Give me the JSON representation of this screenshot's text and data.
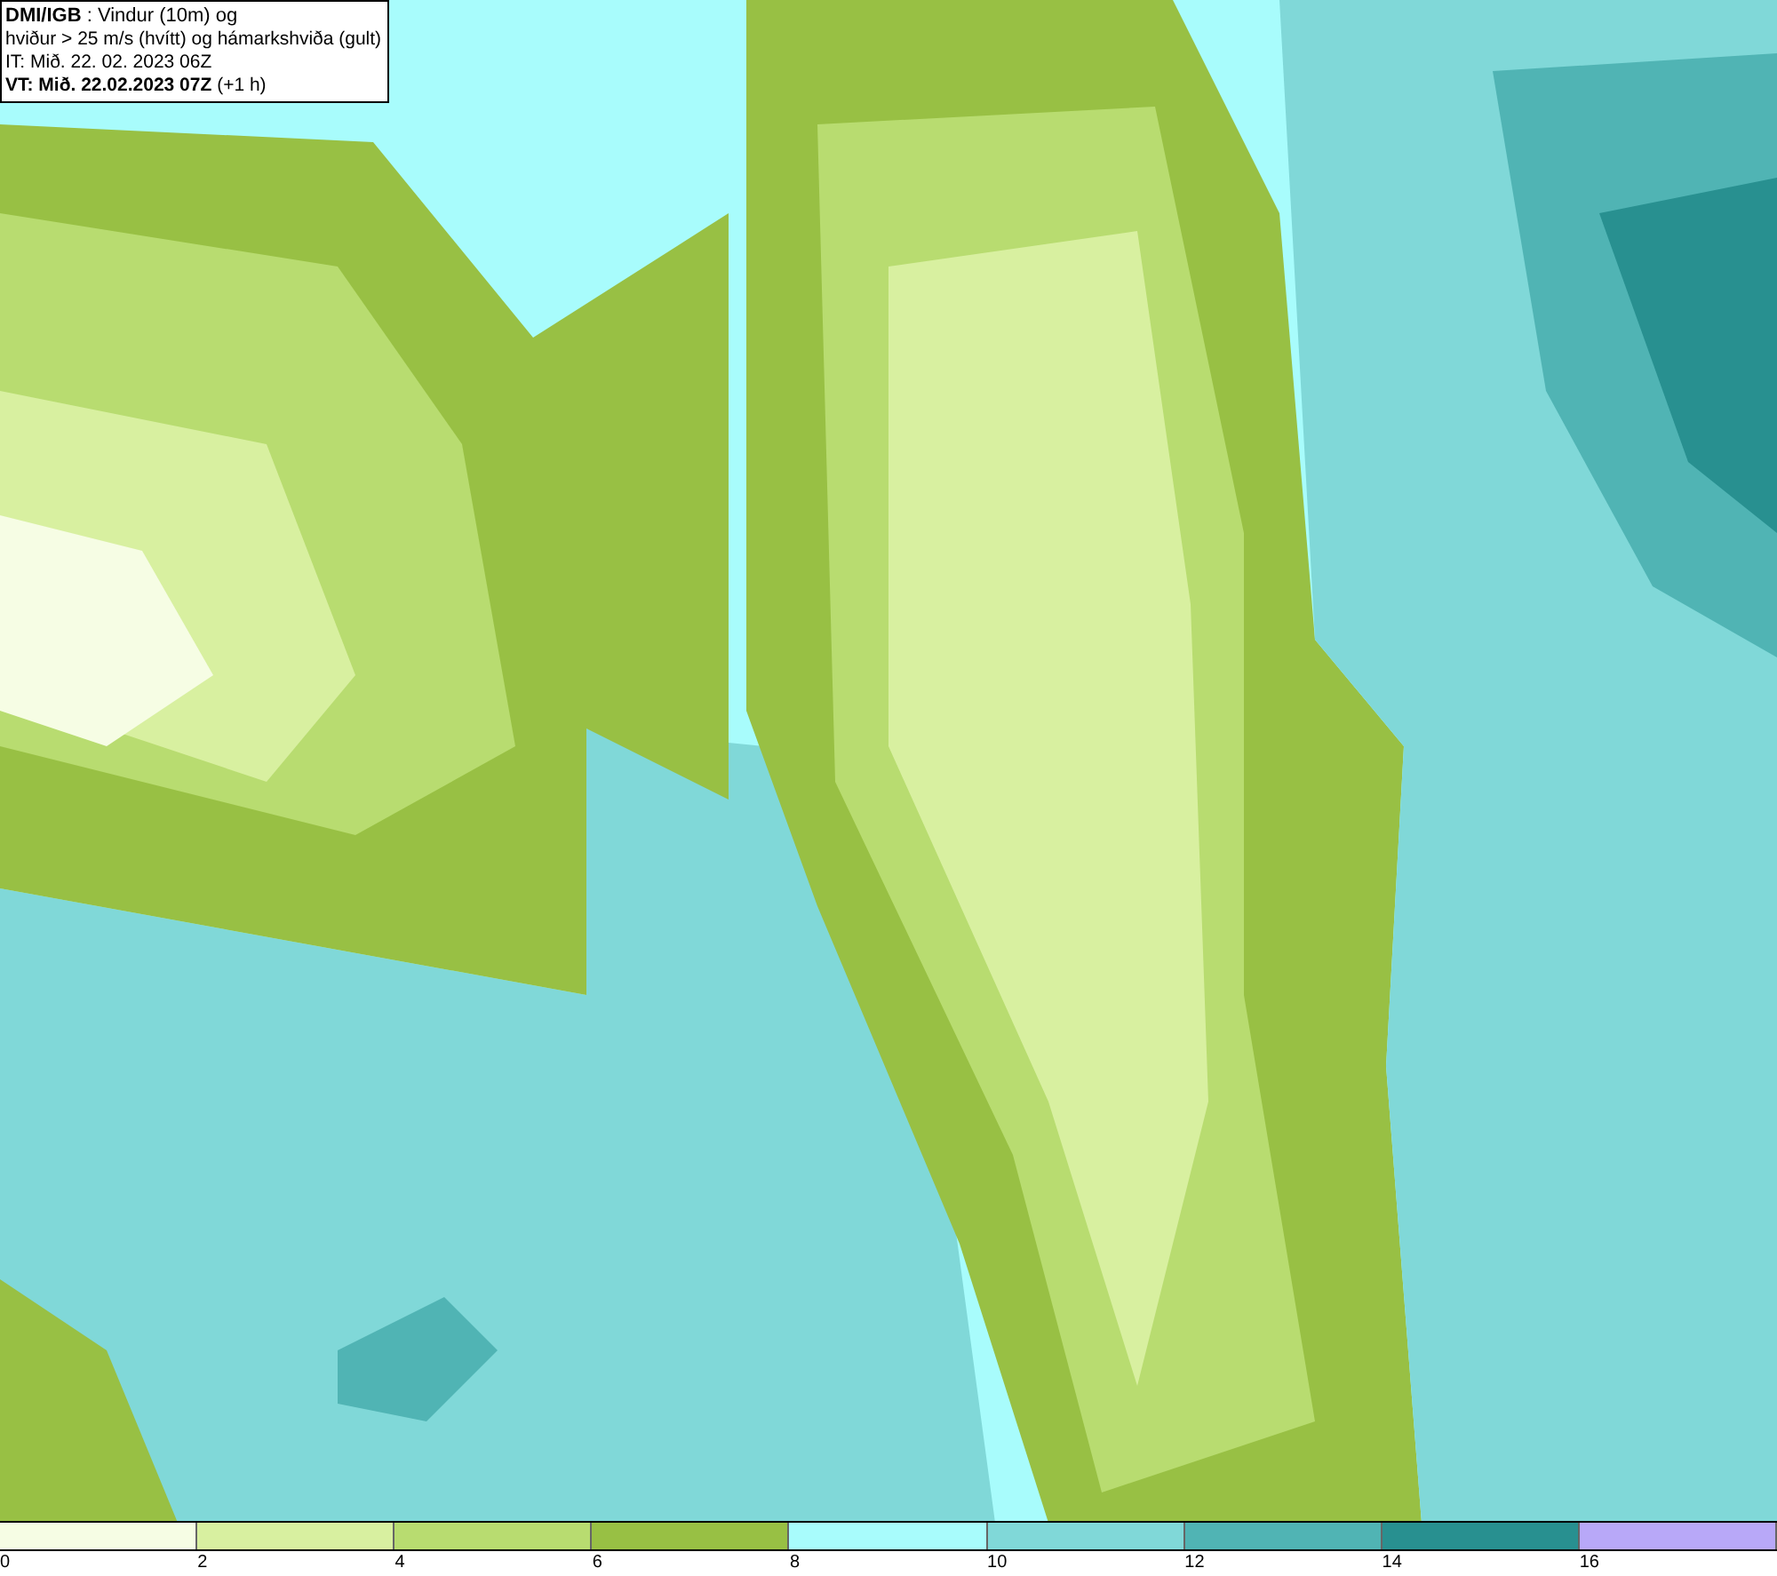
{
  "info_box": {
    "lines": [
      "**DMI/IGB** : Vindur (10m) og",
      "hviður > 25 m/s (hvítt) og hámarkshviða (gult)",
      "IT: Mið. 22. 02. 2023 06Z",
      "**VT: Mið. 22.02.2023 07Z** (+1 h)"
    ]
  },
  "legend": [
    {
      "label": "0",
      "color": "#f6fde4"
    },
    {
      "label": "2",
      "color": "#d8f0a0"
    },
    {
      "label": "4",
      "color": "#b8dc70"
    },
    {
      "label": "6",
      "color": "#98c044"
    },
    {
      "label": "8",
      "color": "#a8fcfc"
    },
    {
      "label": "10",
      "color": "#80d8d8"
    },
    {
      "label": "12",
      "color": "#50b4b4"
    },
    {
      "label": "14",
      "color": "#289090"
    },
    {
      "label": "16",
      "color": "#b8a8f8"
    }
  ]
}
